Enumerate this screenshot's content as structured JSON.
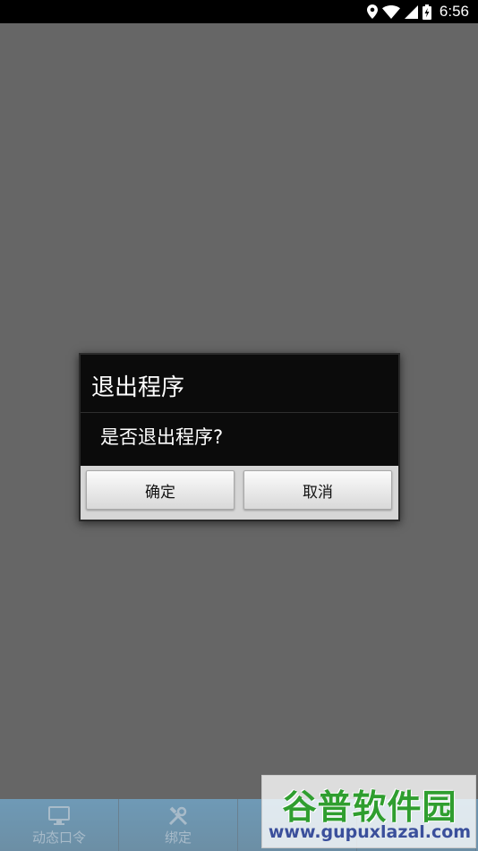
{
  "status_bar": {
    "time": "6:56",
    "icons": [
      "location-icon",
      "wifi-icon",
      "signal-icon",
      "battery-icon"
    ]
  },
  "tab_bar": {
    "tabs": [
      {
        "label": "动态口令",
        "icon": "monitor-icon"
      },
      {
        "label": "绑定",
        "icon": "tools-icon"
      }
    ]
  },
  "dialog": {
    "title": "退出程序",
    "message": "是否退出程序?",
    "confirm_label": "确定",
    "cancel_label": "取消"
  },
  "watermark": {
    "title": "谷普软件园",
    "url": "www.gupuxlazal.com"
  },
  "colors": {
    "scrim": "#666666",
    "dialog_bg": "#0b0b0b",
    "button_bar": "#d6d6d6",
    "tab_bar": "#0c4a75"
  }
}
